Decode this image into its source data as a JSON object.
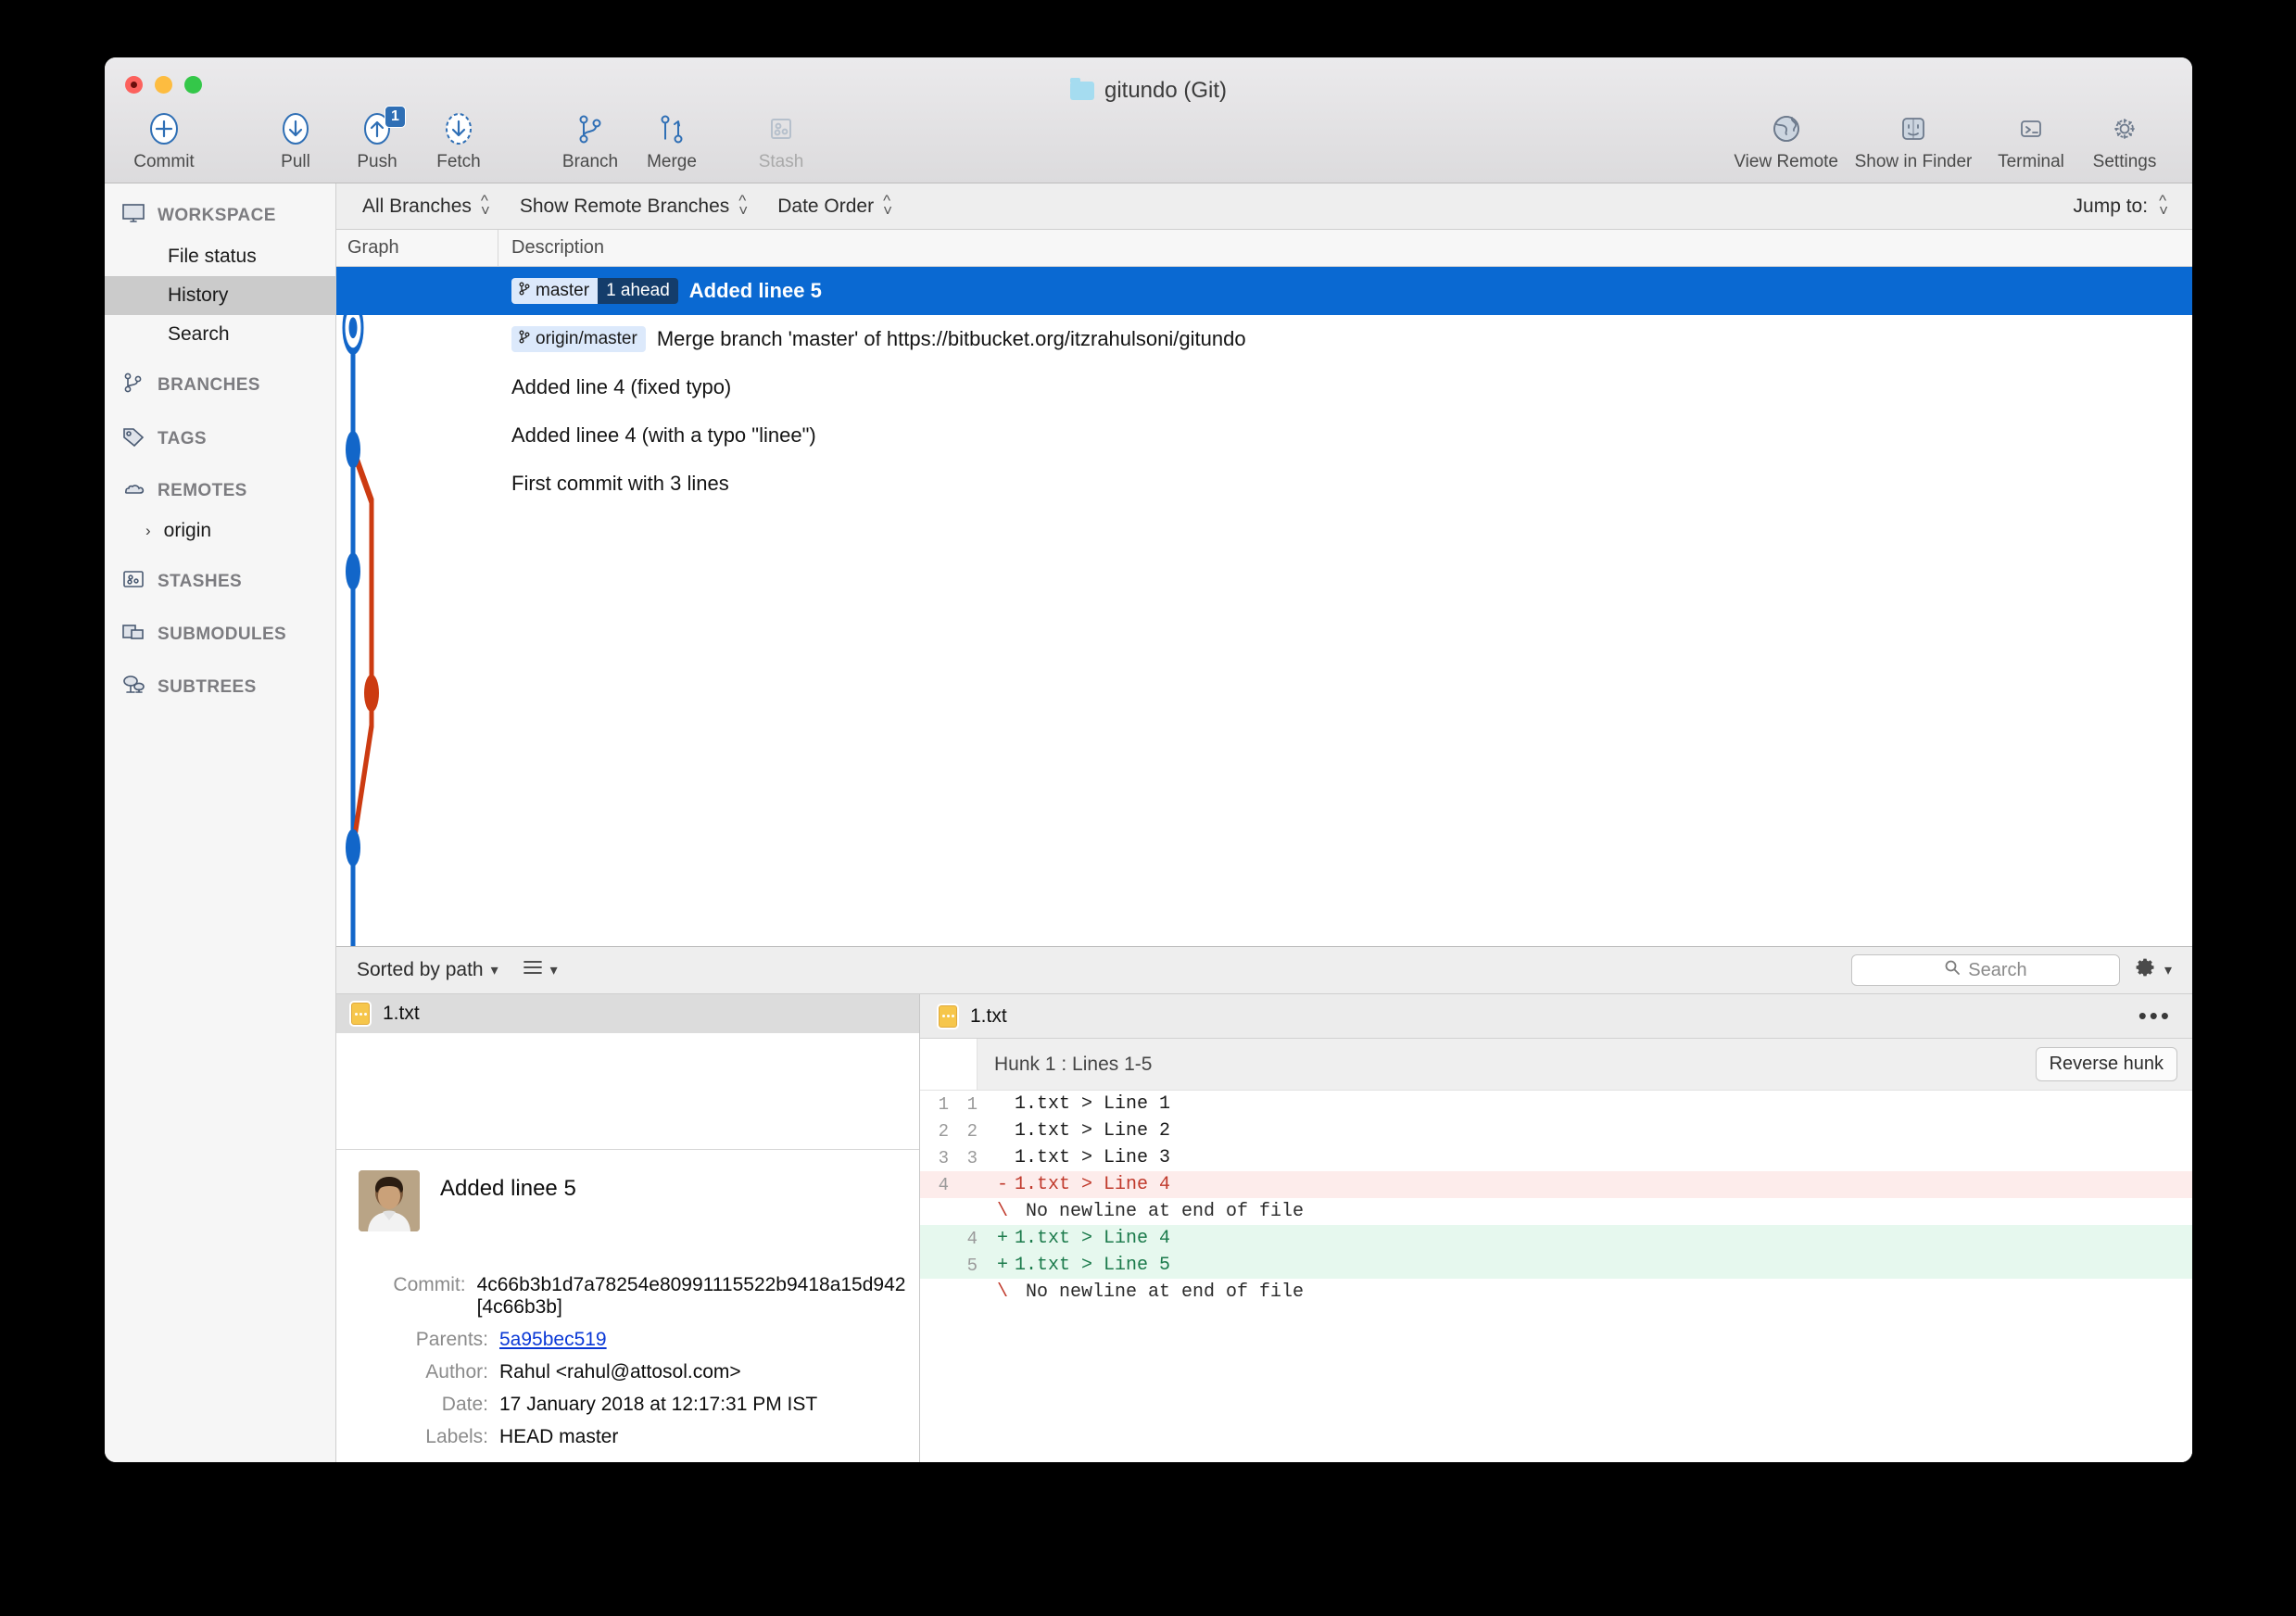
{
  "window": {
    "title": "gitundo (Git)",
    "folder_icon": "folder-icon"
  },
  "toolbar": {
    "left": [
      {
        "label": "Commit",
        "icon": "plus-circle-icon",
        "disabled": false,
        "badge": null
      },
      {
        "label": "Pull",
        "icon": "arrow-down-circle-icon",
        "disabled": false,
        "badge": null
      },
      {
        "label": "Push",
        "icon": "arrow-up-circle-icon",
        "disabled": false,
        "badge": "1"
      },
      {
        "label": "Fetch",
        "icon": "arrow-down-dashed-circle-icon",
        "disabled": false,
        "badge": null
      },
      {
        "label": "Branch",
        "icon": "branch-icon",
        "disabled": false,
        "badge": null
      },
      {
        "label": "Merge",
        "icon": "merge-icon",
        "disabled": false,
        "badge": null
      },
      {
        "label": "Stash",
        "icon": "stash-icon",
        "disabled": true,
        "badge": null
      }
    ],
    "right": [
      {
        "label": "View Remote",
        "icon": "globe-icon"
      },
      {
        "label": "Show in Finder",
        "icon": "finder-icon"
      },
      {
        "label": "Terminal",
        "icon": "terminal-icon"
      },
      {
        "label": "Settings",
        "icon": "gear-icon"
      }
    ]
  },
  "sidebar": {
    "sections": [
      {
        "label": "WORKSPACE",
        "icon": "monitor-icon",
        "items": [
          {
            "label": "File status",
            "selected": false
          },
          {
            "label": "History",
            "selected": true
          },
          {
            "label": "Search",
            "selected": false
          }
        ]
      },
      {
        "label": "BRANCHES",
        "icon": "branch-icon",
        "items": []
      },
      {
        "label": "TAGS",
        "icon": "tag-icon",
        "items": []
      },
      {
        "label": "REMOTES",
        "icon": "cloud-icon",
        "items": [
          {
            "label": "origin",
            "selected": false,
            "expandable": true,
            "chevron": "›"
          }
        ]
      },
      {
        "label": "STASHES",
        "icon": "stash-icon",
        "items": []
      },
      {
        "label": "SUBMODULES",
        "icon": "submodules-icon",
        "items": []
      },
      {
        "label": "SUBTREES",
        "icon": "subtrees-icon",
        "items": []
      }
    ]
  },
  "filterbar": {
    "branch_filter": "All Branches",
    "remote_filter": "Show Remote Branches",
    "order_filter": "Date Order",
    "jump_to": "Jump to:"
  },
  "commit_table": {
    "columns": [
      "Graph",
      "Description"
    ],
    "rows": [
      {
        "ref": "master",
        "ahead": "1 ahead",
        "message": "Added linee 5",
        "selected": true
      },
      {
        "ref": "origin/master",
        "ahead": null,
        "message": "Merge branch 'master' of https://bitbucket.org/itzrahulsoni/gitundo",
        "selected": false
      },
      {
        "ref": null,
        "ahead": null,
        "message": "Added line 4 (fixed typo)",
        "selected": false
      },
      {
        "ref": null,
        "ahead": null,
        "message": "Added linee 4 (with a typo \"linee\")",
        "selected": false
      },
      {
        "ref": null,
        "ahead": null,
        "message": "First commit with 3 lines",
        "selected": false
      }
    ],
    "graph_colors": {
      "main": "#1266c9",
      "branch": "#cc3b11"
    }
  },
  "midbar": {
    "sort_label": "Sorted by path",
    "list_icon": "list-view-icon",
    "search_placeholder": "Search",
    "gear_icon": "gear-icon"
  },
  "file_list": {
    "files": [
      {
        "name": "1.txt",
        "icon": "text-file-icon"
      }
    ]
  },
  "commit_detail": {
    "avatar": "user-avatar",
    "title": "Added linee 5",
    "fields": [
      {
        "key": "Commit:",
        "value": "4c66b3b1d7a78254e80991115522b9418a15d942 [4c66b3b]",
        "link": false
      },
      {
        "key": "Parents:",
        "value": "5a95bec519",
        "link": true
      },
      {
        "key": "Author:",
        "value": "Rahul <rahul@attosol.com>",
        "link": false
      },
      {
        "key": "Date:",
        "value": "17 January 2018 at 12:17:31 PM IST",
        "link": false
      },
      {
        "key": "Labels:",
        "value": "HEAD master",
        "link": false
      }
    ]
  },
  "diff": {
    "file_name": "1.txt",
    "file_icon": "text-file-icon",
    "more_icon": "ellipsis-icon",
    "hunk_label": "Hunk 1 : Lines 1-5",
    "reverse_button": "Reverse hunk",
    "lines": [
      {
        "old": "1",
        "new": "1",
        "sign": "",
        "text": "1.txt > Line 1",
        "type": "ctx"
      },
      {
        "old": "2",
        "new": "2",
        "sign": "",
        "text": "1.txt > Line 2",
        "type": "ctx"
      },
      {
        "old": "3",
        "new": "3",
        "sign": "",
        "text": "1.txt > Line 3",
        "type": "ctx"
      },
      {
        "old": "4",
        "new": "",
        "sign": "-",
        "text": "1.txt > Line 4",
        "type": "del"
      },
      {
        "old": "",
        "new": "",
        "sign": "\\",
        "text": " No newline at end of file",
        "type": "nonl"
      },
      {
        "old": "",
        "new": "4",
        "sign": "+",
        "text": "1.txt > Line 4",
        "type": "add"
      },
      {
        "old": "",
        "new": "5",
        "sign": "+",
        "text": "1.txt > Line 5",
        "type": "add"
      },
      {
        "old": "",
        "new": "",
        "sign": "\\",
        "text": " No newline at end of file",
        "type": "nonl"
      }
    ]
  }
}
